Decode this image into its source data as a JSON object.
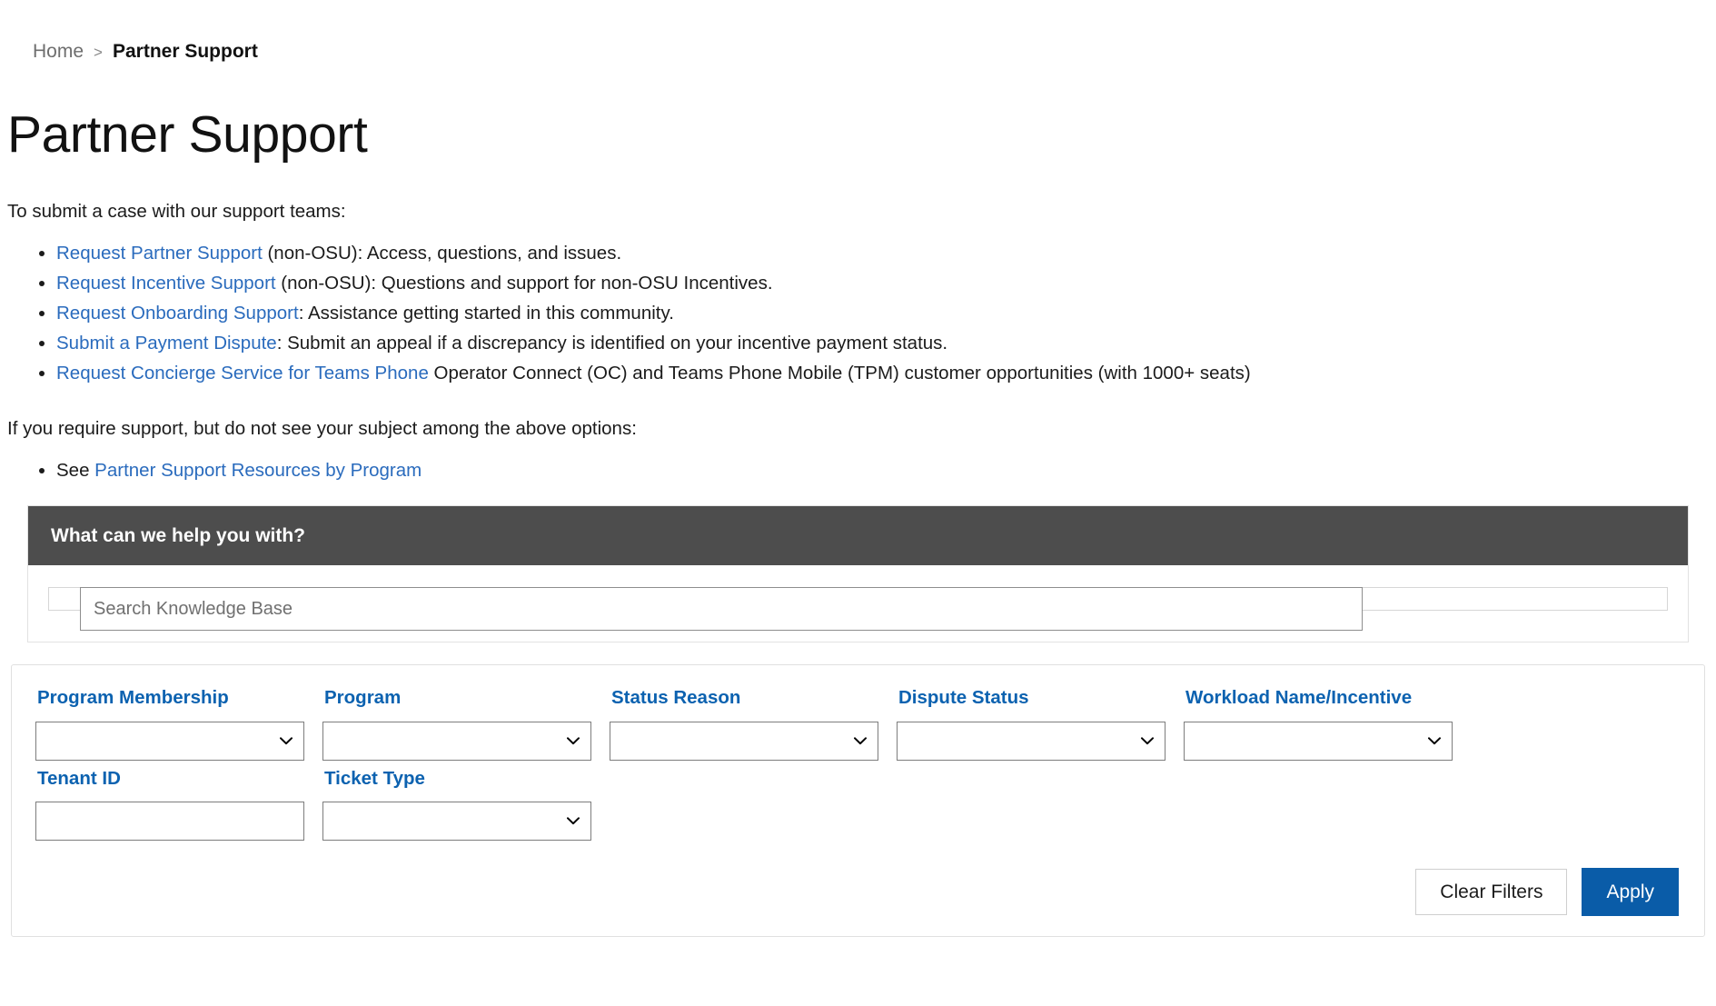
{
  "breadcrumb": {
    "home_label": "Home",
    "separator": ">",
    "current_label": "Partner Support"
  },
  "page": {
    "title": "Partner Support",
    "intro": "To submit a case with our support teams:",
    "note": "If you require support, but do not see your subject among the above options:"
  },
  "support_options": [
    {
      "link": "Request Partner Support",
      "rest": " (non-OSU): Access, questions, and issues."
    },
    {
      "link": "Request Incentive Support",
      "rest": " (non-OSU): Questions and support for non-OSU Incentives."
    },
    {
      "link": "Request Onboarding Support",
      "rest": ": Assistance getting started in this community."
    },
    {
      "link": "Submit a Payment Dispute",
      "rest": ": Submit an appeal if a discrepancy is identified on your incentive payment status."
    },
    {
      "link": "Request Concierge Service for Teams Phone",
      "rest": " Operator Connect (OC) and Teams Phone Mobile (TPM) customer opportunities (with 1000+ seats)"
    }
  ],
  "resources": {
    "prefix": "See ",
    "link": "Partner Support Resources by Program"
  },
  "knowledge_base": {
    "header": "What can we help you with?",
    "search_placeholder": "Search Knowledge Base",
    "search_value": "",
    "header_bg": "#4d4d4d"
  },
  "filters": {
    "label_color": "#0c62b0",
    "row1": [
      {
        "label": "Program Membership",
        "type": "select",
        "value": "",
        "options": [
          ""
        ]
      },
      {
        "label": "Program",
        "type": "select",
        "value": "",
        "options": [
          ""
        ]
      },
      {
        "label": "Status Reason",
        "type": "select",
        "value": "",
        "options": [
          ""
        ]
      },
      {
        "label": "Dispute Status",
        "type": "select",
        "value": "",
        "options": [
          ""
        ]
      },
      {
        "label": "Workload Name/Incentive",
        "type": "select",
        "value": "",
        "options": [
          ""
        ]
      }
    ],
    "row2": [
      {
        "label": "Tenant ID",
        "type": "text",
        "value": "",
        "placeholder": ""
      },
      {
        "label": "Ticket Type",
        "type": "select",
        "value": "",
        "options": [
          ""
        ]
      }
    ],
    "clear_label": "Clear Filters",
    "apply_label": "Apply",
    "apply_color": "#0a5ca8"
  },
  "icons": {
    "chevron_down": "chevron-down-icon"
  }
}
